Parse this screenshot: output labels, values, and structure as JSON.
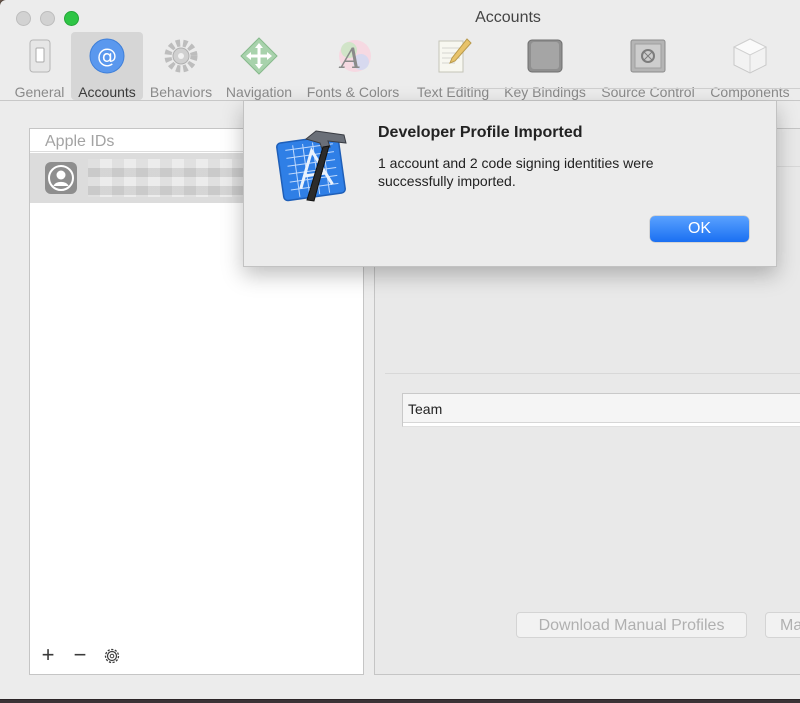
{
  "window": {
    "title": "Accounts"
  },
  "toolbar": {
    "items": [
      {
        "label": "General",
        "icon": "general-switch-icon"
      },
      {
        "label": "Accounts",
        "icon": "at-sign-icon",
        "selected": true
      },
      {
        "label": "Behaviors",
        "icon": "gear-icon"
      },
      {
        "label": "Navigation",
        "icon": "navigation-arrows-icon"
      },
      {
        "label": "Fonts & Colors",
        "icon": "font-palette-icon"
      },
      {
        "label": "Text Editing",
        "icon": "pencil-paper-icon"
      },
      {
        "label": "Key Bindings",
        "icon": "option-key-icon"
      },
      {
        "label": "Source Control",
        "icon": "safe-icon"
      },
      {
        "label": "Components",
        "icon": "cube-icon"
      }
    ]
  },
  "left_panel": {
    "header": "Apple IDs",
    "footer": {
      "add": "+",
      "remove": "−"
    }
  },
  "right_panel": {
    "team_header": "Team",
    "download_button": "Download Manual Profiles",
    "manage_button": "Ma"
  },
  "sheet": {
    "title": "Developer Profile Imported",
    "message": "1 account and 2 code signing identities were successfully imported.",
    "ok_label": "OK"
  },
  "colors": {
    "accent": "#1a6ff2",
    "selected_tab": "#d6d6d6",
    "traffic_green": "#2ec545"
  }
}
